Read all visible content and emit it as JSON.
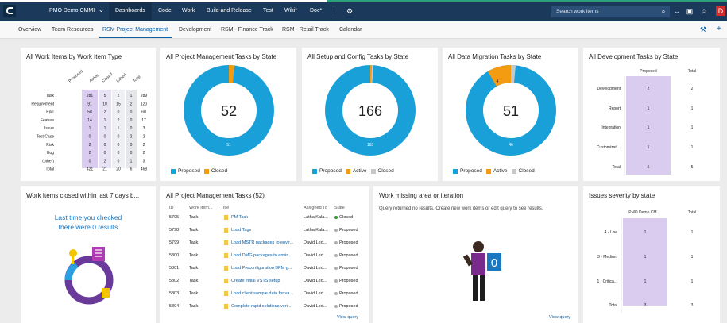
{
  "topbar": {
    "project": "PMO Demo CMMI",
    "nav": [
      "Dashboards",
      "Code",
      "Work",
      "Build and Release",
      "Test",
      "Wiki*",
      "Doc*"
    ],
    "search_placeholder": "Search work items"
  },
  "subnav": {
    "tabs": [
      "Overview",
      "Team Resources",
      "RSM Project Management",
      "Development",
      "RSM - Finance Track",
      "RSM - Retail Track",
      "Calendar"
    ],
    "active_index": 2
  },
  "widgets": {
    "by_type": {
      "title": "All Work Items by Work Item Type",
      "columns": [
        "Proposed",
        "Active",
        "Closed",
        "(other)",
        "Total"
      ],
      "rows": [
        {
          "label": "Task",
          "values": [
            "281",
            "5",
            "2",
            "1",
            "289"
          ]
        },
        {
          "label": "Requirement",
          "values": [
            "91",
            "10",
            "15",
            "2",
            "120"
          ]
        },
        {
          "label": "Epic",
          "values": [
            "58",
            "2",
            "0",
            "0",
            "60"
          ]
        },
        {
          "label": "Feature",
          "values": [
            "14",
            "1",
            "2",
            "0",
            "17"
          ]
        },
        {
          "label": "Issue",
          "values": [
            "1",
            "1",
            "1",
            "0",
            "3"
          ]
        },
        {
          "label": "Test Case",
          "values": [
            "0",
            "0",
            "0",
            "2",
            "2"
          ]
        },
        {
          "label": "Risk",
          "values": [
            "2",
            "0",
            "0",
            "0",
            "2"
          ]
        },
        {
          "label": "Bug",
          "values": [
            "2",
            "0",
            "0",
            "0",
            "2"
          ]
        },
        {
          "label": "(other)",
          "values": [
            "0",
            "2",
            "0",
            "1",
            "3"
          ]
        },
        {
          "label": "Total",
          "values": [
            "421",
            "21",
            "20",
            "6",
            "468"
          ]
        }
      ]
    },
    "pm_tasks": {
      "title": "All Project Management Tasks by State",
      "total": "52",
      "slice_label": "51",
      "legend": [
        "Proposed",
        "Closed"
      ]
    },
    "setup_tasks": {
      "title": "All Setup and Config Tasks by State",
      "total": "166",
      "slice_label": "163",
      "legend": [
        "Proposed",
        "Active",
        "Closed"
      ]
    },
    "migration_tasks": {
      "title": "All Data Migration Tasks by State",
      "total": "51",
      "slice_label": "46",
      "active_label": "4",
      "legend": [
        "Proposed",
        "Active",
        "Closed"
      ]
    },
    "dev_tasks": {
      "title": "All Development Tasks by State",
      "columns": [
        "Proposed",
        "Total"
      ],
      "rows": [
        {
          "label": "Development",
          "values": [
            "2",
            "2"
          ]
        },
        {
          "label": "Report",
          "values": [
            "1",
            "1"
          ]
        },
        {
          "label": "Integration",
          "values": [
            "1",
            "1"
          ]
        },
        {
          "label": "Customizati...",
          "values": [
            "1",
            "1"
          ]
        },
        {
          "label": "Total",
          "values": [
            "5",
            "5"
          ]
        }
      ]
    },
    "closed_week": {
      "title": "Work Items closed within last 7 days b...",
      "message_line1": "Last time you checked",
      "message_line2": "there were 0 results"
    },
    "pm_list": {
      "title": "All Project Management Tasks (52)",
      "headers": [
        "ID",
        "Work Item...",
        "Title",
        "Assigned To",
        "State"
      ],
      "rows": [
        {
          "id": "5795",
          "type": "Task",
          "title": "PM Task",
          "assigned": "Latha Kala...",
          "state": "Closed"
        },
        {
          "id": "5798",
          "type": "Task",
          "title": "Load Tags",
          "assigned": "Latha Kala...",
          "state": "Proposed"
        },
        {
          "id": "5799",
          "type": "Task",
          "title": "Load MSTR packages to envir...",
          "assigned": "David Led...",
          "state": "Proposed"
        },
        {
          "id": "5800",
          "type": "Task",
          "title": "Load DMG packages to envir...",
          "assigned": "David Led...",
          "state": "Proposed"
        },
        {
          "id": "5801",
          "type": "Task",
          "title": "Load Preconfiguration BPM g...",
          "assigned": "David Led...",
          "state": "Proposed"
        },
        {
          "id": "5802",
          "type": "Task",
          "title": "Create initial VSTS setup",
          "assigned": "David Led...",
          "state": "Proposed"
        },
        {
          "id": "5803",
          "type": "Task",
          "title": "Load client sample data for va...",
          "assigned": "David Led...",
          "state": "Proposed"
        },
        {
          "id": "5804",
          "type": "Task",
          "title": "Complete rapid solutions veri...",
          "assigned": "David Led...",
          "state": "Proposed"
        }
      ],
      "view_query": "View query"
    },
    "missing_area": {
      "title": "Work missing area or iteration",
      "message": "Query returned no results. Create new work items or edit query to see results.",
      "view_query": "View query"
    },
    "severity": {
      "title": "Issues severity by state",
      "columns": [
        "PMO Demo CM...",
        "Total"
      ],
      "rows": [
        {
          "label": "4 - Low",
          "values": [
            "1",
            "1"
          ]
        },
        {
          "label": "3 - Medium",
          "values": [
            "1",
            "1"
          ]
        },
        {
          "label": "1 - Critica...",
          "values": [
            "1",
            "1"
          ]
        },
        {
          "label": "Total",
          "values": [
            "3",
            "3"
          ]
        }
      ]
    }
  },
  "colors": {
    "proposed": "#1aa0d8",
    "active": "#f39c12",
    "closed": "#c8c8c8",
    "heat": "#d9ccef",
    "topbar": "#1b3a5b"
  },
  "icons": [
    "search-icon",
    "chevron-down-icon",
    "gear-icon",
    "bag-icon",
    "person-icon",
    "wrench-icon",
    "plus-icon"
  ]
}
